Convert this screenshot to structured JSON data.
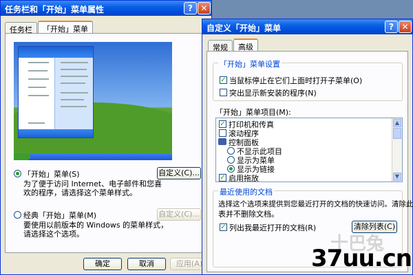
{
  "left_dialog": {
    "title": "任务栏和「开始」菜单属性",
    "tabs": [
      {
        "label": "任务栏",
        "active": false
      },
      {
        "label": "「开始」菜单",
        "active": true
      }
    ],
    "options": [
      {
        "label": "「开始」菜单(S)",
        "description_line1": "为了便于访问 Internet、电子邮件和您喜",
        "description_line2": "欢的程序，请选择这个菜单样式。",
        "selected": true,
        "customize_label": "自定义(C)...",
        "customize_enabled": true
      },
      {
        "label": "经典「开始」菜单(M)",
        "description_line1": "要使用以前版本的 Windows 的菜单样式，",
        "description_line2": "请选择这个选项。",
        "selected": false,
        "customize_label": "自定义(C)...",
        "customize_enabled": false
      }
    ],
    "buttons": {
      "ok": "确定",
      "cancel": "取消",
      "apply": "应用(A)"
    }
  },
  "right_dialog": {
    "title": "自定义「开始」菜单",
    "tabs": [
      {
        "label": "常规",
        "active": false
      },
      {
        "label": "高级",
        "active": true
      }
    ],
    "settings_group": {
      "title": "「开始」菜单设置",
      "items": [
        {
          "label": "当鼠标停止在它们上面时打开子菜单(O)",
          "checked": true
        },
        {
          "label": "突出显示新安装的程序(N)",
          "checked": false
        }
      ]
    },
    "items_group": {
      "title": "「开始」菜单项目(M):",
      "items": [
        {
          "label": "打印机和传真",
          "kind": "checkbox",
          "checked": true
        },
        {
          "label": "滚动程序",
          "kind": "checkbox",
          "checked": false
        },
        {
          "label": "控制面板",
          "kind": "folder"
        },
        {
          "label": "不显示此项目",
          "kind": "radio",
          "checked": false
        },
        {
          "label": "显示为菜单",
          "kind": "radio",
          "checked": false
        },
        {
          "label": "显示为链接",
          "kind": "radio",
          "checked": true
        },
        {
          "label": "启用拖放",
          "kind": "checkbox",
          "checked": true
        }
      ]
    },
    "recent_group": {
      "title": "最近使用的文档",
      "description_line1": "选择这个选项来提供到您最近打开的文档的快速访问。清除此列",
      "description_line2": "表并不删除文档。",
      "list_checkbox_label": "列出我最近打开的文档(R)",
      "list_checked": true,
      "clear_button": "清除列表(C)"
    }
  },
  "watermark": {
    "main": "37uu.cn",
    "faint": "十巴兔"
  },
  "icons": {
    "help": "?",
    "close": "✕",
    "check": "✓",
    "scroll_up": "▲",
    "scroll_down": "▼"
  }
}
